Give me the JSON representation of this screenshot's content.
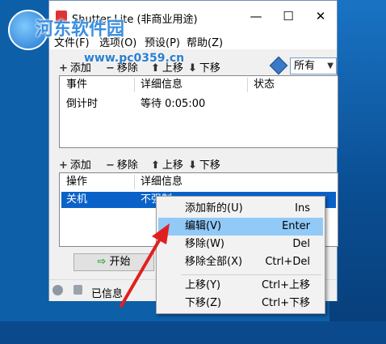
{
  "window": {
    "title": "Shutter Lite (非商业用途)",
    "controls": {
      "minimize": "—",
      "maximize": "☐",
      "close": "✕"
    }
  },
  "menu": [
    "文件(F)",
    "选项(O)",
    "预设(P)",
    "帮助(Z)"
  ],
  "events_toolbar": {
    "add": "添加",
    "remove": "移除",
    "up": "上移",
    "down": "下移"
  },
  "filter": {
    "selected": "所有"
  },
  "events_list": {
    "columns": [
      "事件",
      "详细信息",
      "状态"
    ],
    "rows": [
      {
        "event": "倒计时",
        "detail": "等待 0:05:00",
        "status": ""
      }
    ]
  },
  "actions_toolbar": {
    "add": "添加",
    "remove": "移除",
    "up": "上移",
    "down": "下移"
  },
  "actions_list": {
    "columns": [
      "操作",
      "详细信息"
    ],
    "rows": [
      {
        "action": "关机",
        "detail": "不强制"
      }
    ]
  },
  "start_button": "开始",
  "status_bar": {
    "text": "已信息"
  },
  "context_menu": [
    {
      "label": "添加新的(U)",
      "key": "Ins"
    },
    {
      "label": "编辑(V)",
      "key": "Enter",
      "highlighted": true
    },
    {
      "label": "移除(W)",
      "key": "Del"
    },
    {
      "label": "移除全部(X)",
      "key": "Ctrl+Del"
    },
    {
      "label": "上移(Y)",
      "key": "Ctrl+上移"
    },
    {
      "label": "下移(Z)",
      "key": "Ctrl+下移"
    }
  ],
  "watermark": {
    "brand": "河东软件园",
    "url": "www.pc0359.cn"
  },
  "colors": {
    "selection": "#0a62c8",
    "menu_highlight": "#91c9f7",
    "arrow": "#e02020",
    "desktop": "#0d5fa8"
  }
}
